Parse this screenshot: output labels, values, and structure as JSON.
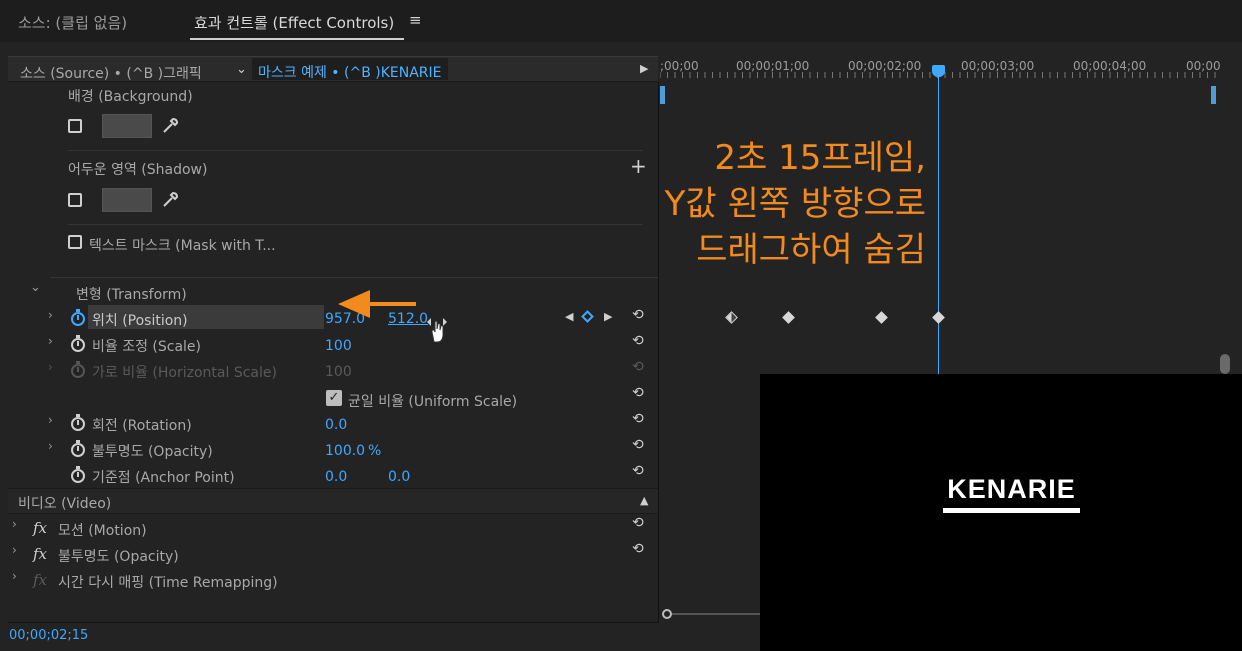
{
  "tabs": {
    "source": "소스: (클립 없음)",
    "effect_controls": "효과 컨트롤 (Effect Controls)",
    "menu_glyph": "≡"
  },
  "header": {
    "source_clip": "소스 (Source) • (^B )그래픽",
    "sequence_clip": "마스크 예제 • (^B )KENARIE"
  },
  "mask_section": {
    "background_label": "배경 (Background)",
    "shadow_label": "어두운 영역 (Shadow)",
    "mask_text_label": "텍스트 마스크 (Mask with T..."
  },
  "transform": {
    "label": "변형 (Transform)",
    "position_label": "위치 (Position)",
    "position_x": "957.0",
    "position_y": "512.0",
    "scale_label": "비율 조정 (Scale)",
    "scale_value": "100",
    "hscale_label": "가로 비율 (Horizontal Scale)",
    "hscale_value": "100",
    "uniform_label": "균일 비율 (Uniform Scale)",
    "uniform_checked": true,
    "rotation_label": "회전 (Rotation)",
    "rotation_value": "0.0",
    "opacity_label": "불투명도 (Opacity)",
    "opacity_value": "100.0",
    "opacity_unit": "%",
    "anchor_label": "기준점 (Anchor Point)",
    "anchor_x": "0.0",
    "anchor_y": "0.0"
  },
  "video": {
    "label": "비디오 (Video)",
    "motion_label": "모션 (Motion)",
    "opacity_label": "불투명도 (Opacity)",
    "time_remap_label": "시간 다시 매핑 (Time Remapping)"
  },
  "timeline": {
    "ticks": [
      ";00;00",
      "00;00;01;00",
      "00;00;02;00",
      "00;00;03;00",
      "00;00;04;00",
      "00;00"
    ],
    "playhead_color": "#3fa8ff"
  },
  "annotation": {
    "line1": "2초 15프레임,",
    "line2": "Y값 왼쪽 방향으로",
    "line3": "드래그하여 숨김",
    "color": "#f28a1e"
  },
  "preview": {
    "logo_text": "KENARIE"
  },
  "footer": {
    "timecode": "00;00;02;15"
  },
  "icons": {
    "eyedropper": "eyedropper-icon",
    "reset": "reset-icon",
    "stopwatch": "stopwatch-icon",
    "fx": "fx-icon"
  }
}
